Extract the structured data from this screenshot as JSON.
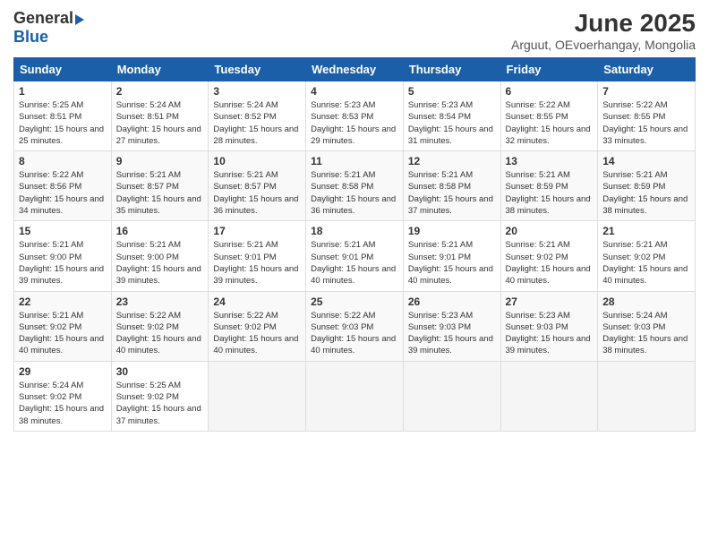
{
  "logo": {
    "general": "General",
    "blue": "Blue"
  },
  "title": "June 2025",
  "location": "Arguut, OEvoerhangay, Mongolia",
  "headers": [
    "Sunday",
    "Monday",
    "Tuesday",
    "Wednesday",
    "Thursday",
    "Friday",
    "Saturday"
  ],
  "weeks": [
    [
      {
        "day": "1",
        "sunrise": "Sunrise: 5:25 AM",
        "sunset": "Sunset: 8:51 PM",
        "daylight": "Daylight: 15 hours and 25 minutes."
      },
      {
        "day": "2",
        "sunrise": "Sunrise: 5:24 AM",
        "sunset": "Sunset: 8:51 PM",
        "daylight": "Daylight: 15 hours and 27 minutes."
      },
      {
        "day": "3",
        "sunrise": "Sunrise: 5:24 AM",
        "sunset": "Sunset: 8:52 PM",
        "daylight": "Daylight: 15 hours and 28 minutes."
      },
      {
        "day": "4",
        "sunrise": "Sunrise: 5:23 AM",
        "sunset": "Sunset: 8:53 PM",
        "daylight": "Daylight: 15 hours and 29 minutes."
      },
      {
        "day": "5",
        "sunrise": "Sunrise: 5:23 AM",
        "sunset": "Sunset: 8:54 PM",
        "daylight": "Daylight: 15 hours and 31 minutes."
      },
      {
        "day": "6",
        "sunrise": "Sunrise: 5:22 AM",
        "sunset": "Sunset: 8:55 PM",
        "daylight": "Daylight: 15 hours and 32 minutes."
      },
      {
        "day": "7",
        "sunrise": "Sunrise: 5:22 AM",
        "sunset": "Sunset: 8:55 PM",
        "daylight": "Daylight: 15 hours and 33 minutes."
      }
    ],
    [
      {
        "day": "8",
        "sunrise": "Sunrise: 5:22 AM",
        "sunset": "Sunset: 8:56 PM",
        "daylight": "Daylight: 15 hours and 34 minutes."
      },
      {
        "day": "9",
        "sunrise": "Sunrise: 5:21 AM",
        "sunset": "Sunset: 8:57 PM",
        "daylight": "Daylight: 15 hours and 35 minutes."
      },
      {
        "day": "10",
        "sunrise": "Sunrise: 5:21 AM",
        "sunset": "Sunset: 8:57 PM",
        "daylight": "Daylight: 15 hours and 36 minutes."
      },
      {
        "day": "11",
        "sunrise": "Sunrise: 5:21 AM",
        "sunset": "Sunset: 8:58 PM",
        "daylight": "Daylight: 15 hours and 36 minutes."
      },
      {
        "day": "12",
        "sunrise": "Sunrise: 5:21 AM",
        "sunset": "Sunset: 8:58 PM",
        "daylight": "Daylight: 15 hours and 37 minutes."
      },
      {
        "day": "13",
        "sunrise": "Sunrise: 5:21 AM",
        "sunset": "Sunset: 8:59 PM",
        "daylight": "Daylight: 15 hours and 38 minutes."
      },
      {
        "day": "14",
        "sunrise": "Sunrise: 5:21 AM",
        "sunset": "Sunset: 8:59 PM",
        "daylight": "Daylight: 15 hours and 38 minutes."
      }
    ],
    [
      {
        "day": "15",
        "sunrise": "Sunrise: 5:21 AM",
        "sunset": "Sunset: 9:00 PM",
        "daylight": "Daylight: 15 hours and 39 minutes."
      },
      {
        "day": "16",
        "sunrise": "Sunrise: 5:21 AM",
        "sunset": "Sunset: 9:00 PM",
        "daylight": "Daylight: 15 hours and 39 minutes."
      },
      {
        "day": "17",
        "sunrise": "Sunrise: 5:21 AM",
        "sunset": "Sunset: 9:01 PM",
        "daylight": "Daylight: 15 hours and 39 minutes."
      },
      {
        "day": "18",
        "sunrise": "Sunrise: 5:21 AM",
        "sunset": "Sunset: 9:01 PM",
        "daylight": "Daylight: 15 hours and 40 minutes."
      },
      {
        "day": "19",
        "sunrise": "Sunrise: 5:21 AM",
        "sunset": "Sunset: 9:01 PM",
        "daylight": "Daylight: 15 hours and 40 minutes."
      },
      {
        "day": "20",
        "sunrise": "Sunrise: 5:21 AM",
        "sunset": "Sunset: 9:02 PM",
        "daylight": "Daylight: 15 hours and 40 minutes."
      },
      {
        "day": "21",
        "sunrise": "Sunrise: 5:21 AM",
        "sunset": "Sunset: 9:02 PM",
        "daylight": "Daylight: 15 hours and 40 minutes."
      }
    ],
    [
      {
        "day": "22",
        "sunrise": "Sunrise: 5:21 AM",
        "sunset": "Sunset: 9:02 PM",
        "daylight": "Daylight: 15 hours and 40 minutes."
      },
      {
        "day": "23",
        "sunrise": "Sunrise: 5:22 AM",
        "sunset": "Sunset: 9:02 PM",
        "daylight": "Daylight: 15 hours and 40 minutes."
      },
      {
        "day": "24",
        "sunrise": "Sunrise: 5:22 AM",
        "sunset": "Sunset: 9:02 PM",
        "daylight": "Daylight: 15 hours and 40 minutes."
      },
      {
        "day": "25",
        "sunrise": "Sunrise: 5:22 AM",
        "sunset": "Sunset: 9:03 PM",
        "daylight": "Daylight: 15 hours and 40 minutes."
      },
      {
        "day": "26",
        "sunrise": "Sunrise: 5:23 AM",
        "sunset": "Sunset: 9:03 PM",
        "daylight": "Daylight: 15 hours and 39 minutes."
      },
      {
        "day": "27",
        "sunrise": "Sunrise: 5:23 AM",
        "sunset": "Sunset: 9:03 PM",
        "daylight": "Daylight: 15 hours and 39 minutes."
      },
      {
        "day": "28",
        "sunrise": "Sunrise: 5:24 AM",
        "sunset": "Sunset: 9:03 PM",
        "daylight": "Daylight: 15 hours and 38 minutes."
      }
    ],
    [
      {
        "day": "29",
        "sunrise": "Sunrise: 5:24 AM",
        "sunset": "Sunset: 9:02 PM",
        "daylight": "Daylight: 15 hours and 38 minutes."
      },
      {
        "day": "30",
        "sunrise": "Sunrise: 5:25 AM",
        "sunset": "Sunset: 9:02 PM",
        "daylight": "Daylight: 15 hours and 37 minutes."
      },
      null,
      null,
      null,
      null,
      null
    ]
  ]
}
